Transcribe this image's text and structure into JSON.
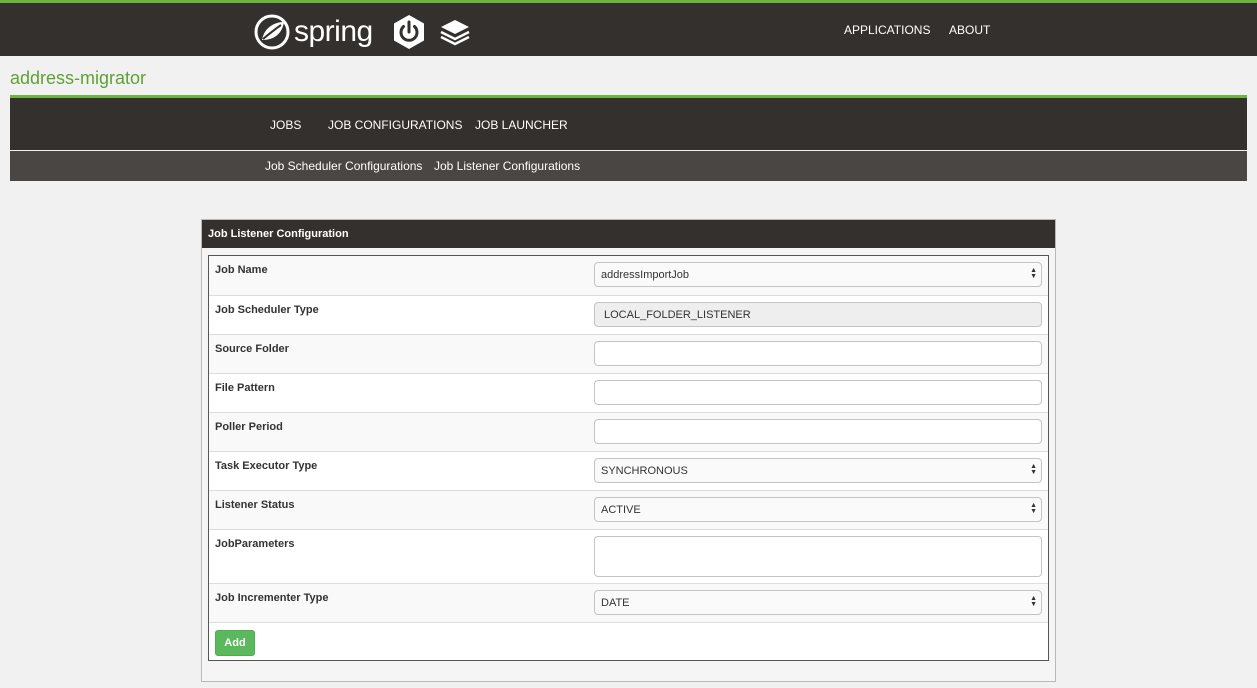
{
  "header": {
    "brand": "spring",
    "nav": [
      {
        "label": "APPLICATIONS"
      },
      {
        "label": "ABOUT"
      }
    ],
    "icons": [
      "spring-leaf-icon",
      "spring-boot-power-icon",
      "layers-stack-icon"
    ]
  },
  "app_title": "address-migrator",
  "primary_nav": [
    {
      "label": "JOBS"
    },
    {
      "label": "JOB CONFIGURATIONS"
    },
    {
      "label": "JOB LAUNCHER"
    }
  ],
  "secondary_nav": [
    {
      "label": "Job Scheduler Configurations"
    },
    {
      "label": "Job Listener Configurations"
    }
  ],
  "panel": {
    "title": "Job Listener Configuration",
    "fields": {
      "job_name": {
        "label": "Job Name",
        "value": "addressImportJob"
      },
      "scheduler_type": {
        "label": "Job Scheduler Type",
        "value": "LOCAL_FOLDER_LISTENER"
      },
      "source_folder": {
        "label": "Source Folder",
        "value": ""
      },
      "file_pattern": {
        "label": "File Pattern",
        "value": ""
      },
      "poller_period": {
        "label": "Poller Period",
        "value": ""
      },
      "task_executor_type": {
        "label": "Task Executor Type",
        "value": "SYNCHRONOUS"
      },
      "listener_status": {
        "label": "Listener Status",
        "value": "ACTIVE"
      },
      "job_parameters": {
        "label": "JobParameters",
        "value": ""
      },
      "incrementer_type": {
        "label": "Job Incrementer Type",
        "value": "DATE"
      }
    },
    "add_label": "Add"
  },
  "colors": {
    "accent_green": "#6db33f",
    "dark_bar": "#34302d",
    "button_green": "#5cb85c"
  }
}
